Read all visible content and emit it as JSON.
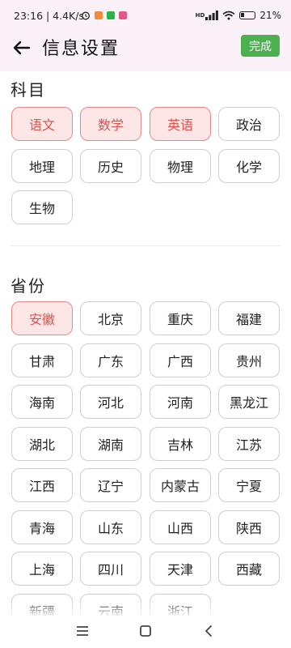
{
  "status_bar": {
    "time_speed": "23:16 | 4.4K/s",
    "net_label": "HD",
    "battery_text": "21%"
  },
  "header": {
    "title": "信息设置",
    "done_label": "完成"
  },
  "subjects": {
    "title": "科目",
    "items": [
      {
        "label": "语文",
        "selected": true
      },
      {
        "label": "数学",
        "selected": true
      },
      {
        "label": "英语",
        "selected": true
      },
      {
        "label": "政治",
        "selected": false
      },
      {
        "label": "地理",
        "selected": false
      },
      {
        "label": "历史",
        "selected": false
      },
      {
        "label": "物理",
        "selected": false
      },
      {
        "label": "化学",
        "selected": false
      },
      {
        "label": "生物",
        "selected": false
      }
    ]
  },
  "provinces": {
    "title": "省份",
    "items": [
      {
        "label": "安徽",
        "selected": true
      },
      {
        "label": "北京",
        "selected": false
      },
      {
        "label": "重庆",
        "selected": false
      },
      {
        "label": "福建",
        "selected": false
      },
      {
        "label": "甘肃",
        "selected": false
      },
      {
        "label": "广东",
        "selected": false
      },
      {
        "label": "广西",
        "selected": false
      },
      {
        "label": "贵州",
        "selected": false
      },
      {
        "label": "海南",
        "selected": false
      },
      {
        "label": "河北",
        "selected": false
      },
      {
        "label": "河南",
        "selected": false
      },
      {
        "label": "黑龙江",
        "selected": false
      },
      {
        "label": "湖北",
        "selected": false
      },
      {
        "label": "湖南",
        "selected": false
      },
      {
        "label": "吉林",
        "selected": false
      },
      {
        "label": "江苏",
        "selected": false
      },
      {
        "label": "江西",
        "selected": false
      },
      {
        "label": "辽宁",
        "selected": false
      },
      {
        "label": "内蒙古",
        "selected": false
      },
      {
        "label": "宁夏",
        "selected": false
      },
      {
        "label": "青海",
        "selected": false
      },
      {
        "label": "山东",
        "selected": false
      },
      {
        "label": "山西",
        "selected": false
      },
      {
        "label": "陕西",
        "selected": false
      },
      {
        "label": "上海",
        "selected": false
      },
      {
        "label": "四川",
        "selected": false
      },
      {
        "label": "天津",
        "selected": false
      },
      {
        "label": "西藏",
        "selected": false
      },
      {
        "label": "新疆",
        "selected": false
      },
      {
        "label": "云南",
        "selected": false
      },
      {
        "label": "浙江",
        "selected": false
      }
    ]
  },
  "colors": {
    "accent_green": "#4caf50",
    "selected_fill": "#fde6e6",
    "selected_text": "#d9534f",
    "header_bg": "#fbf1f8"
  },
  "icons": [
    "back-arrow-icon",
    "alarm-icon",
    "signal-icon",
    "wifi-icon",
    "battery-icon",
    "menu-icon",
    "home-icon",
    "back-nav-icon"
  ]
}
